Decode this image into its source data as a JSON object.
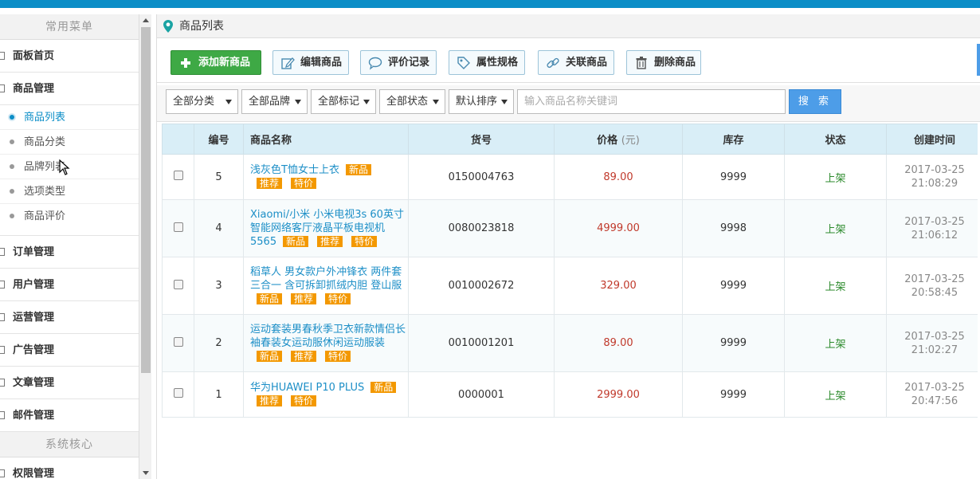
{
  "sidebar": {
    "common_header": "常用菜单",
    "items": [
      {
        "label": "面板首页"
      },
      {
        "label": "商品管理"
      }
    ],
    "sub_items": [
      {
        "label": "商品列表"
      },
      {
        "label": "商品分类"
      },
      {
        "label": "品牌列表"
      },
      {
        "label": "选项类型"
      },
      {
        "label": "商品评价"
      }
    ],
    "groups": [
      {
        "label": "订单管理"
      },
      {
        "label": "用户管理"
      },
      {
        "label": "运营管理"
      },
      {
        "label": "广告管理"
      },
      {
        "label": "文章管理"
      },
      {
        "label": "邮件管理"
      }
    ],
    "core_header": "系统核心",
    "partial_item": "权限管理"
  },
  "page": {
    "title": "商品列表"
  },
  "toolbar": {
    "add": "添加新商品",
    "edit": "编辑商品",
    "reviews": "评价记录",
    "attrs": "属性规格",
    "related": "关联商品",
    "delete": "删除商品"
  },
  "filters": {
    "category": "全部分类",
    "brand": "全部品牌",
    "mark": "全部标记",
    "status": "全部状态",
    "sort": "默认排序",
    "search_placeholder": "输入商品名称关键词",
    "search_button": "搜 索"
  },
  "table": {
    "headers": {
      "id": "编号",
      "name": "商品名称",
      "sku": "货号",
      "price": "价格",
      "price_unit": "(元)",
      "stock": "库存",
      "status": "状态",
      "created": "创建时间"
    },
    "rows": [
      {
        "id": "5",
        "name": "浅灰色T恤女士上衣",
        "tags": [
          "新品",
          "推荐",
          "特价"
        ],
        "sku": "0150004763",
        "price": "89.00",
        "stock": "9999",
        "status": "上架",
        "date": "2017-03-25",
        "time": "21:08:29"
      },
      {
        "id": "4",
        "name": "Xiaomi/小米 小米电视3s 60英寸智能网络客厅液晶平板电视机5565",
        "tags": [
          "新品",
          "推荐",
          "特价"
        ],
        "sku": "0080023818",
        "price": "4999.00",
        "stock": "9998",
        "status": "上架",
        "date": "2017-03-25",
        "time": "21:06:12"
      },
      {
        "id": "3",
        "name": "稻草人 男女款户外冲锋衣 两件套三合一 含可拆卸抓绒内胆 登山服",
        "tags": [
          "新品",
          "推荐",
          "特价"
        ],
        "sku": "0010002672",
        "price": "329.00",
        "stock": "9999",
        "status": "上架",
        "date": "2017-03-25",
        "time": "20:58:45"
      },
      {
        "id": "2",
        "name": "运动套装男春秋季卫衣新款情侣长袖春装女运动服休闲运动服装",
        "tags": [
          "新品",
          "推荐",
          "特价"
        ],
        "sku": "0010001201",
        "price": "89.00",
        "stock": "9999",
        "status": "上架",
        "date": "2017-03-25",
        "time": "21:02:27"
      },
      {
        "id": "1",
        "name": "华为HUAWEI P10 PLUS",
        "tags": [
          "新品",
          "推荐",
          "特价"
        ],
        "sku": "0000001",
        "price": "2999.00",
        "stock": "9999",
        "status": "上架",
        "date": "2017-03-25",
        "time": "20:47:56"
      }
    ]
  },
  "colors": {
    "accent": "#0c8ec7",
    "tag": "#f39800",
    "add_button": "#3ea945",
    "price": "#c0392b",
    "status": "#2b8a2b"
  }
}
